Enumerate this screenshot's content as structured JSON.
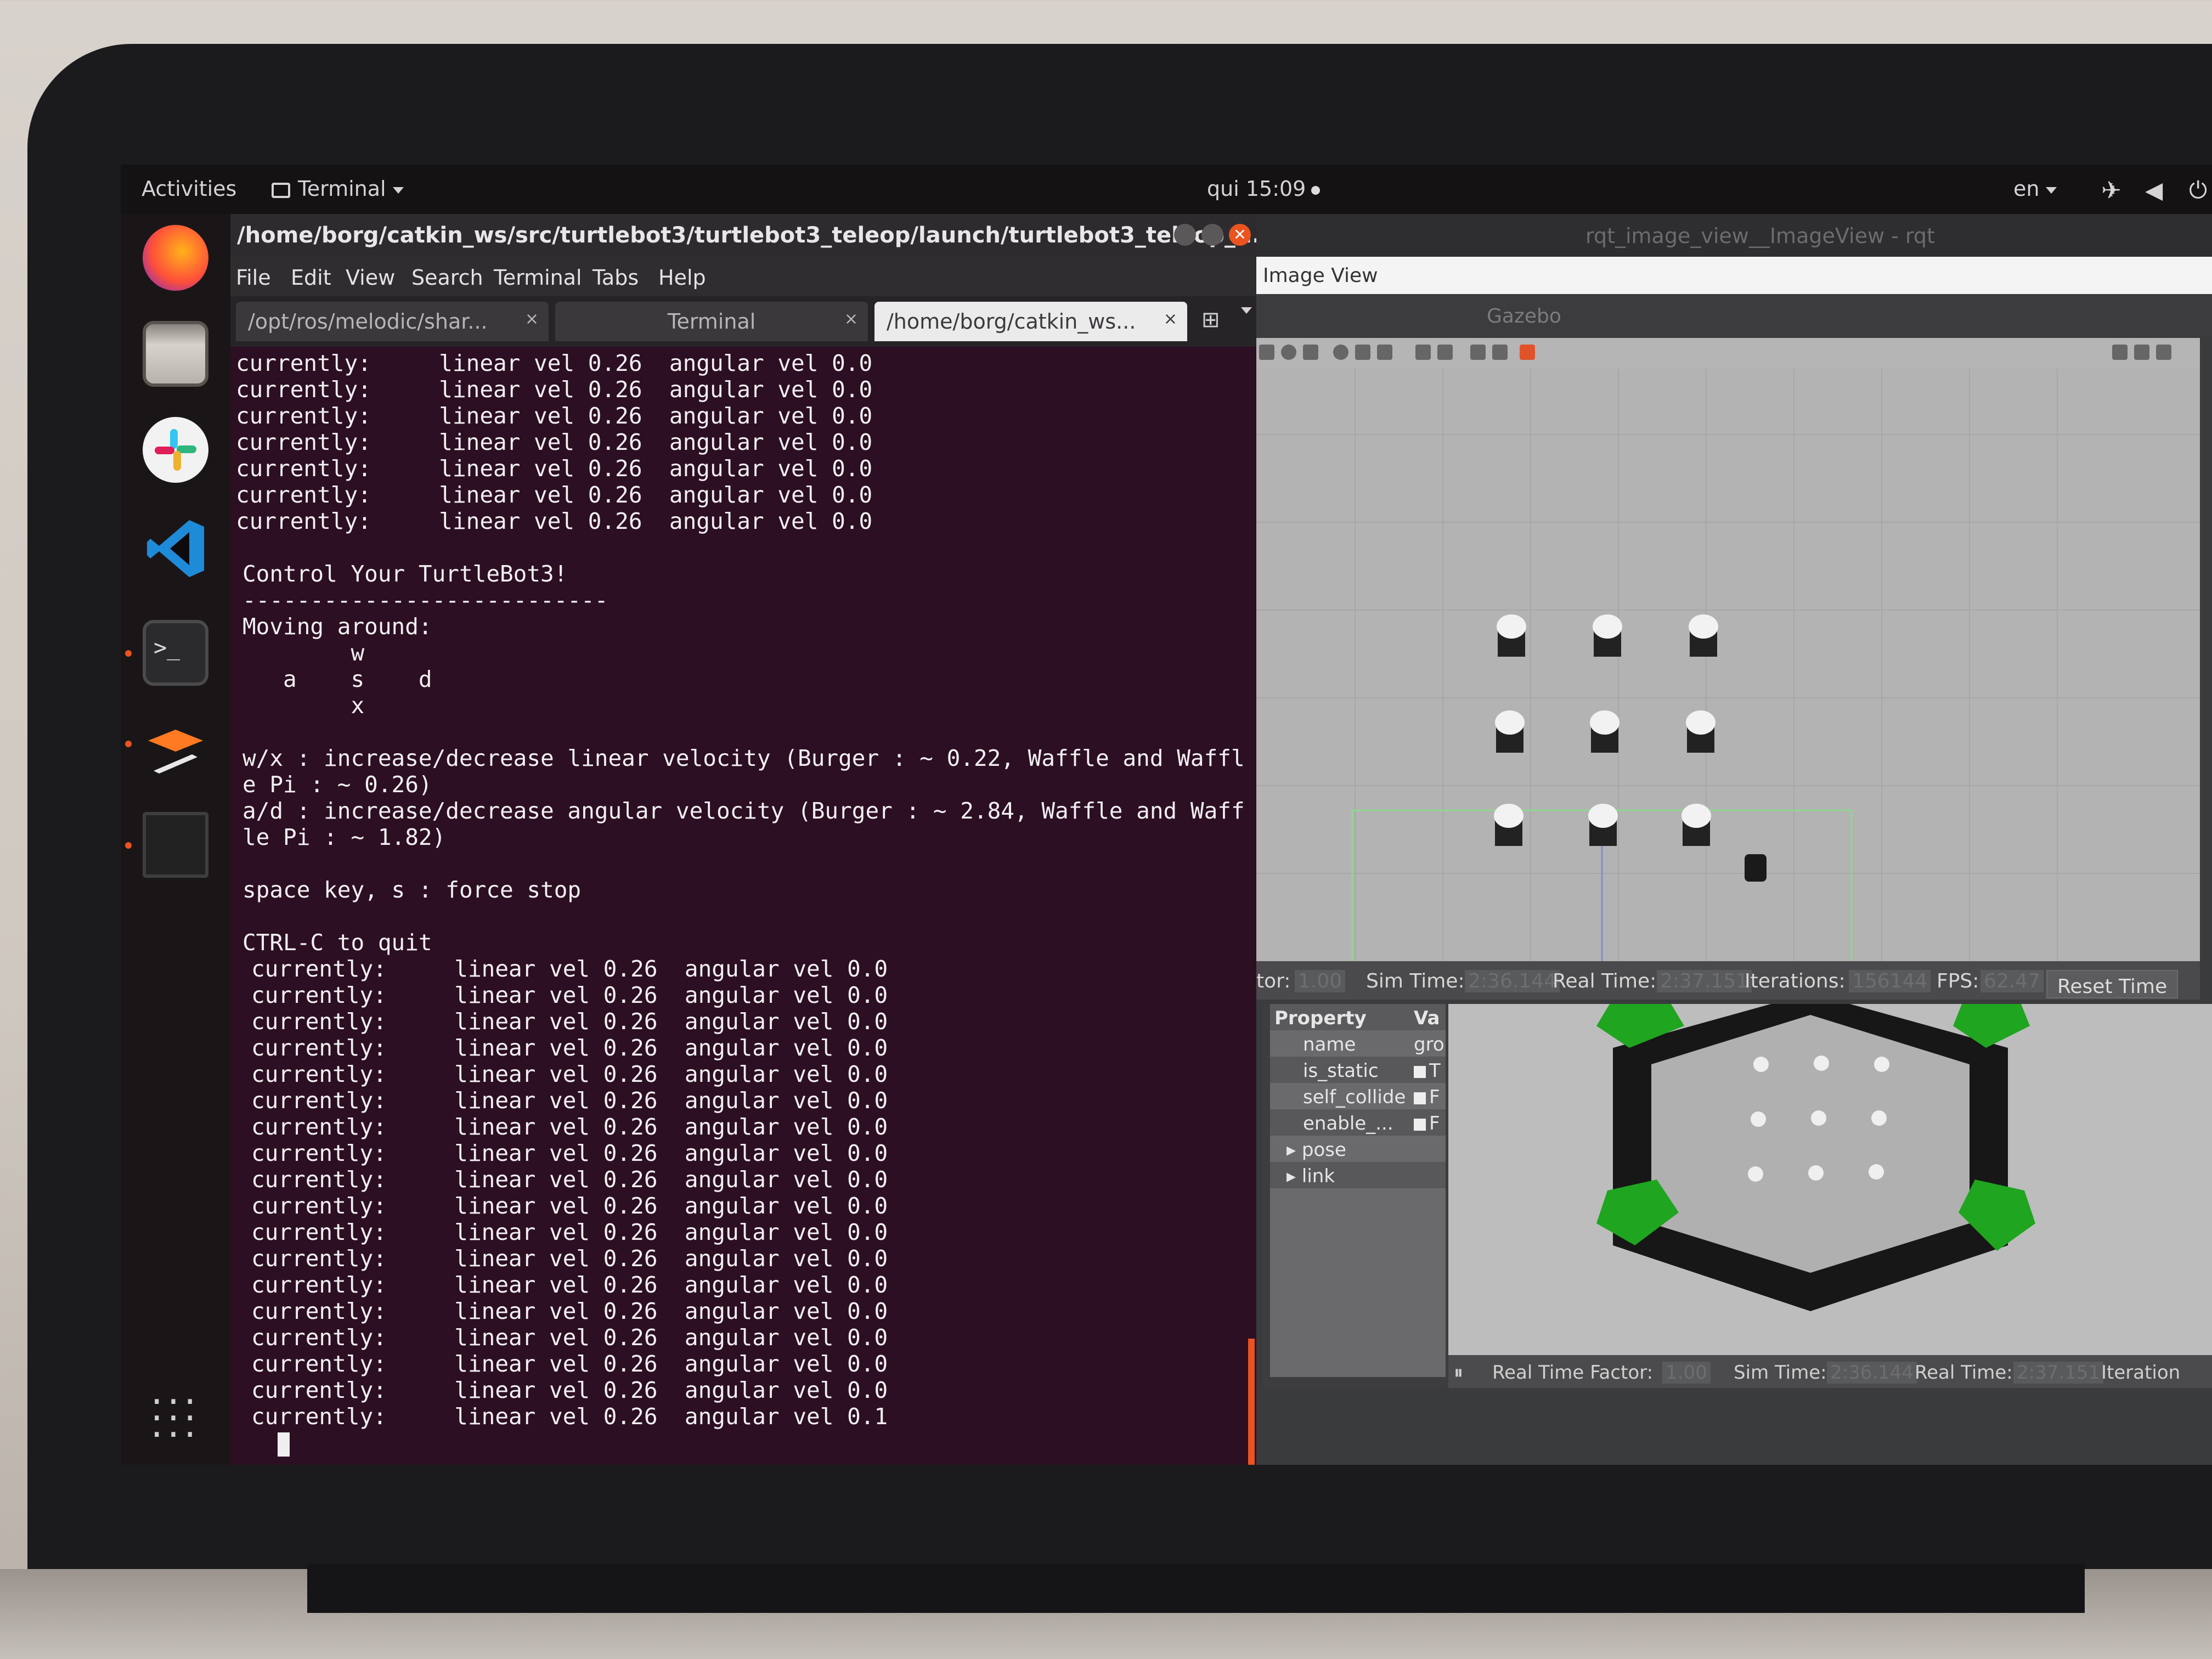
{
  "topbar": {
    "activities": "Activities",
    "app_menu": "Terminal",
    "clock": "qui 15:09",
    "lang": "en"
  },
  "dock": {
    "items": [
      "firefox-icon",
      "files-icon",
      "slack-icon",
      "vscode-icon",
      "terminal-icon",
      "sublime-icon",
      "monitor-icon",
      "show-apps-icon"
    ]
  },
  "terminal": {
    "title": "/home/borg/catkin_ws/src/turtlebot3/turtlebot3_teleop/launch/turtlebot3_teleop_...",
    "menu": [
      "File",
      "Edit",
      "View",
      "Search",
      "Terminal",
      "Tabs",
      "Help"
    ],
    "tabs": [
      {
        "label": "/opt/ros/melodic/shar..."
      },
      {
        "label": "Terminal"
      },
      {
        "label": "/home/borg/catkin_ws..."
      }
    ],
    "lines_top": [
      "currently:     linear vel 0.26  angular vel 0.0",
      "currently:     linear vel 0.26  angular vel 0.0",
      "currently:     linear vel 0.26  angular vel 0.0",
      "currently:     linear vel 0.26  angular vel 0.0",
      "currently:     linear vel 0.26  angular vel 0.0",
      "currently:     linear vel 0.26  angular vel 0.0",
      "currently:     linear vel 0.26  angular vel 0.0"
    ],
    "help_text": "\nControl Your TurtleBot3!\n---------------------------\nMoving around:\n        w\n   a    s    d\n        x\n\nw/x : increase/decrease linear velocity (Burger : ~ 0.22, Waffle and Waffl\ne Pi : ~ 0.26)\na/d : increase/decrease angular velocity (Burger : ~ 2.84, Waffle and Waff\nle Pi : ~ 1.82)\n\nspace key, s : force stop\n\nCTRL-C to quit\n",
    "lines_bottom": [
      "currently:     linear vel 0.26  angular vel 0.0",
      "currently:     linear vel 0.26  angular vel 0.0",
      "currently:     linear vel 0.26  angular vel 0.0",
      "currently:     linear vel 0.26  angular vel 0.0",
      "currently:     linear vel 0.26  angular vel 0.0",
      "currently:     linear vel 0.26  angular vel 0.0",
      "currently:     linear vel 0.26  angular vel 0.0",
      "currently:     linear vel 0.26  angular vel 0.0",
      "currently:     linear vel 0.26  angular vel 0.0",
      "currently:     linear vel 0.26  angular vel 0.0",
      "currently:     linear vel 0.26  angular vel 0.0",
      "currently:     linear vel 0.26  angular vel 0.0",
      "currently:     linear vel 0.26  angular vel 0.0",
      "currently:     linear vel 0.26  angular vel 0.0",
      "currently:     linear vel 0.26  angular vel 0.0",
      "currently:     linear vel 0.26  angular vel 0.0",
      "currently:     linear vel 0.26  angular vel 0.0",
      "currently:     linear vel 0.26  angular vel 0.1"
    ]
  },
  "image_view": {
    "window_title": "rqt_image_view__ImageView - rqt",
    "label": "Image View"
  },
  "gazebo": {
    "title": "Gazebo",
    "status": {
      "rtf_label": "tor:",
      "rtf_value": "1.00",
      "sim_label": "Sim Time:",
      "sim_value": "2:36.144",
      "real_label": "Real Time:",
      "real_value": "2:37.151",
      "iter_label": "Iterations:",
      "iter_value": "156144",
      "fps_label": "FPS:",
      "fps_value": "62.47",
      "reset_label": "Reset Time"
    }
  },
  "gazebo2": {
    "props_header": [
      "Property",
      "Va"
    ],
    "props": [
      {
        "name": "name",
        "value": "gro"
      },
      {
        "name": "is_static",
        "value": "T"
      },
      {
        "name": "self_collide",
        "value": "F"
      },
      {
        "name": "enable_...",
        "value": "F"
      },
      {
        "name": "pose",
        "value": ""
      },
      {
        "name": "link",
        "value": ""
      }
    ],
    "status": {
      "rtf_label": "Real Time Factor:",
      "rtf_value": "1.00",
      "sim_label": "Sim Time:",
      "sim_value": "2:36.144",
      "real_label": "Real Time:",
      "real_value": "2:37.151",
      "iter_label": "Iteration"
    }
  },
  "colors": {
    "terminal_bg": "#2c0f22",
    "ubuntu_orange": "#e95420",
    "gazebo_ground": "#b3b3b3",
    "wall_green": "#1fa51f"
  }
}
